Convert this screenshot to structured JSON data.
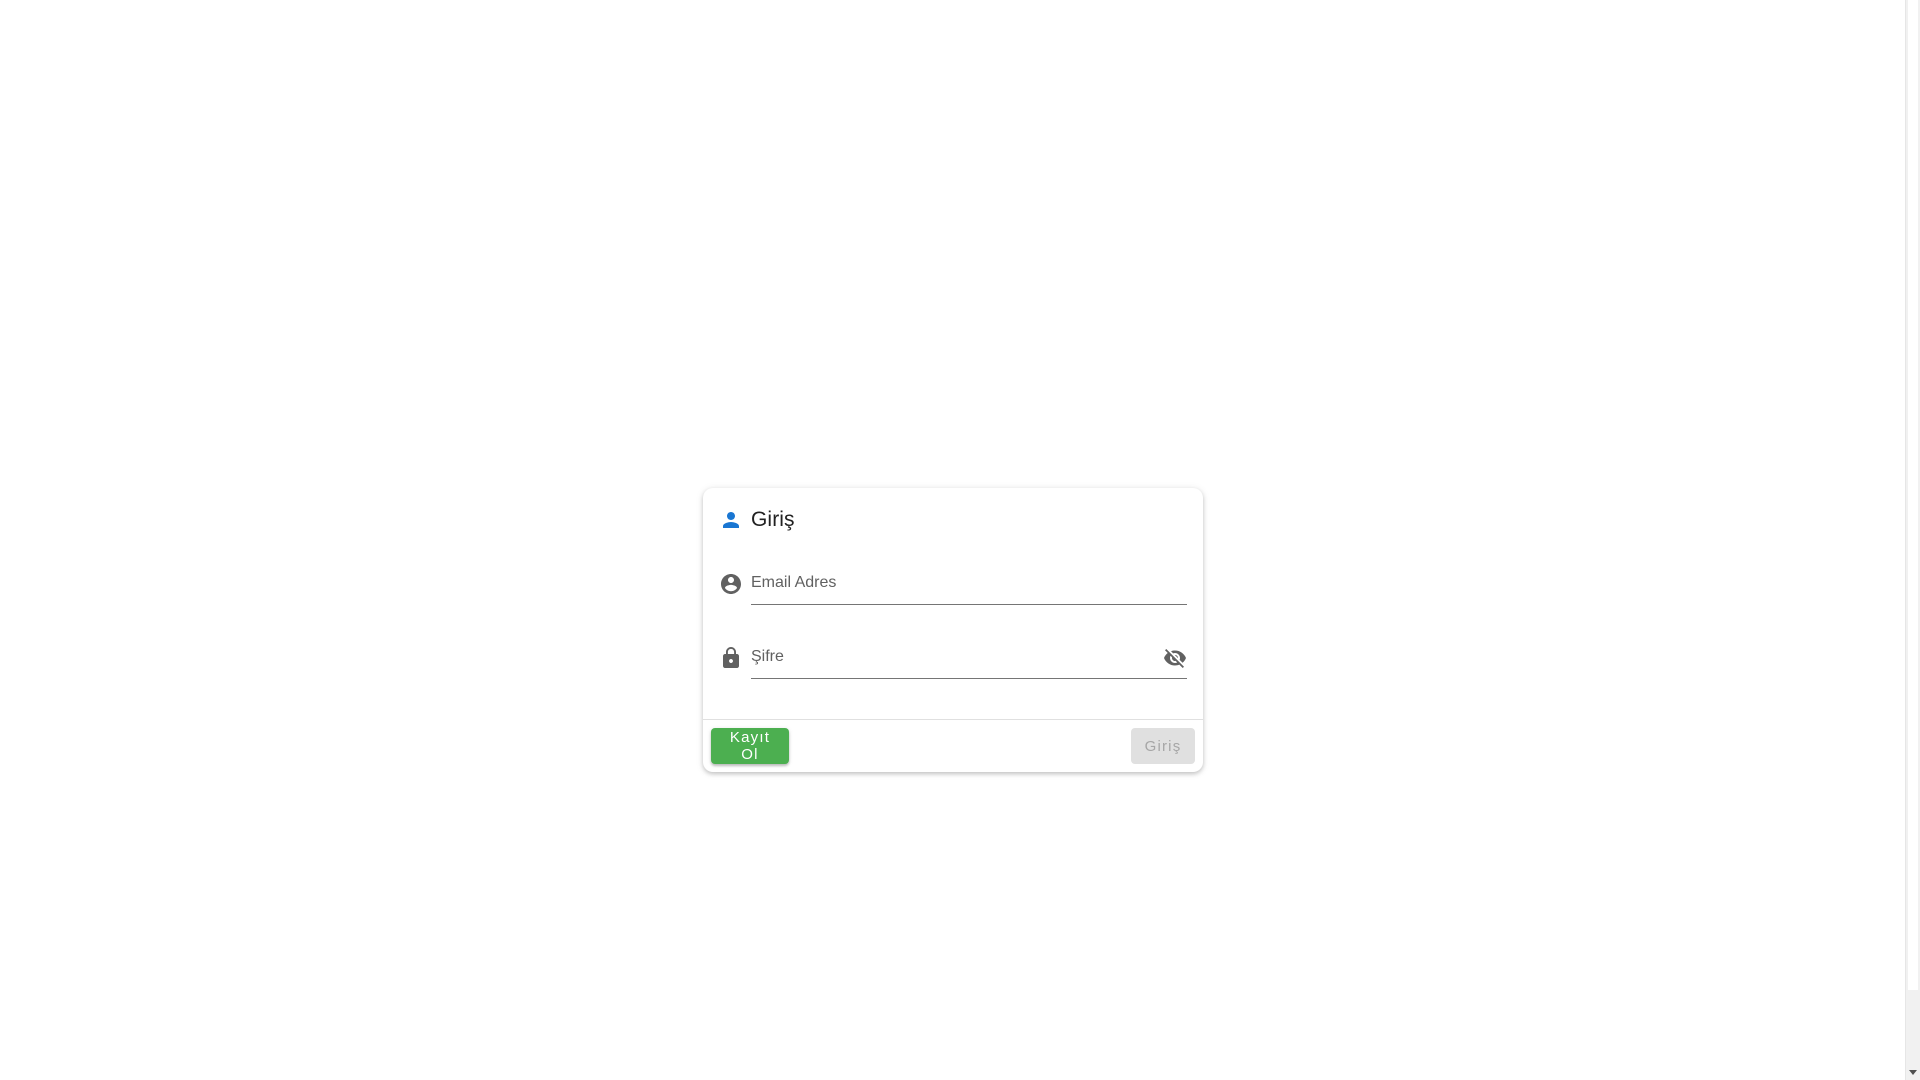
{
  "card": {
    "title": "Giriş",
    "title_icon": "person-icon"
  },
  "email_field": {
    "placeholder": "Email Adres",
    "value": "",
    "icon": "account-circle-icon"
  },
  "password_field": {
    "placeholder": "Şifre",
    "value": "",
    "icon": "lock-icon",
    "toggle_icon": "visibility-off-icon"
  },
  "actions": {
    "register_label": "Kayıt Ol",
    "login_label": "Giriş"
  },
  "colors": {
    "accent_blue": "#1976d2",
    "register_green": "#4caf50",
    "disabled_gray": "#e0e0e0",
    "icon_gray": "#616161"
  }
}
